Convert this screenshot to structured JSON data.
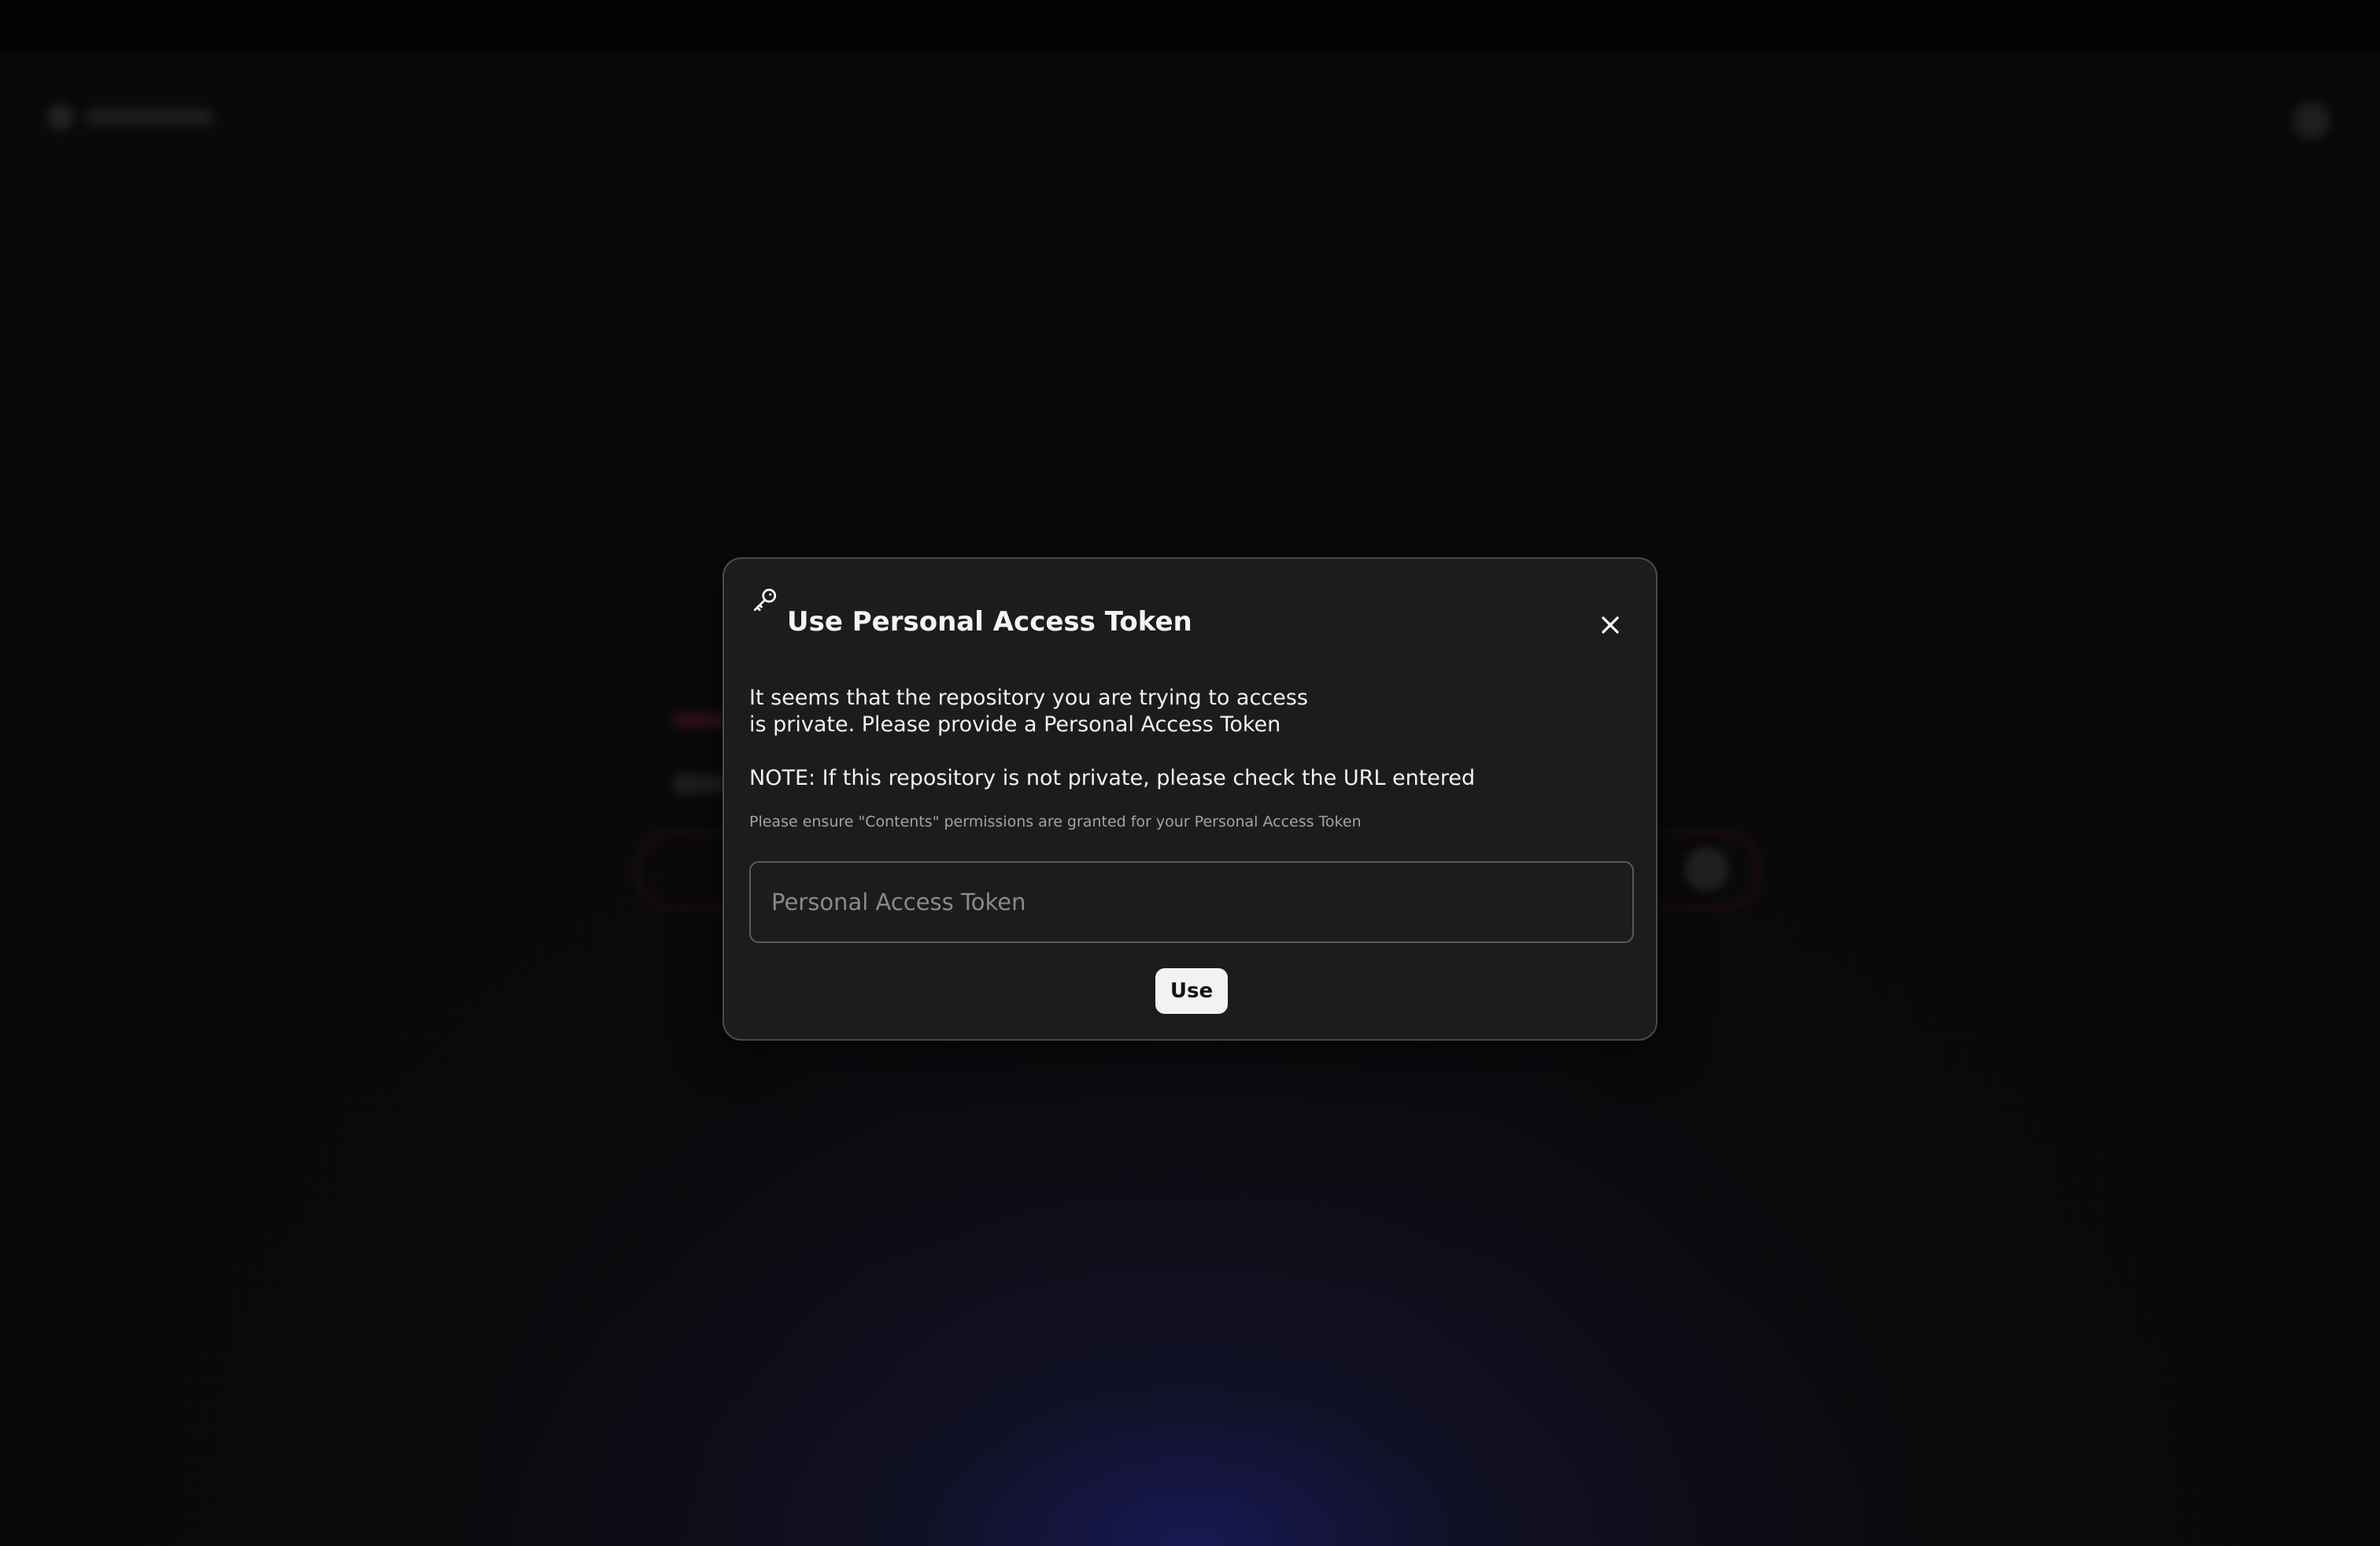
{
  "modal": {
    "title": "Use Personal Access Token",
    "description": "It seems that the repository you are trying to access is private. Please provide a Personal Access Token",
    "note": "NOTE: If this repository is not private, please check the URL entered",
    "hint": "Please ensure \"Contents\" permissions are granted for your Personal Access Token",
    "token_input": {
      "placeholder": "Personal Access Token",
      "value": ""
    },
    "use_label": "Use",
    "icons": {
      "header": "key-icon",
      "close": "close-icon"
    }
  },
  "colors": {
    "modal_bg": "#1c1c1c",
    "modal_border": "#4a4a4a",
    "button_bg": "#f2f2f2",
    "glow": "#28289a"
  }
}
